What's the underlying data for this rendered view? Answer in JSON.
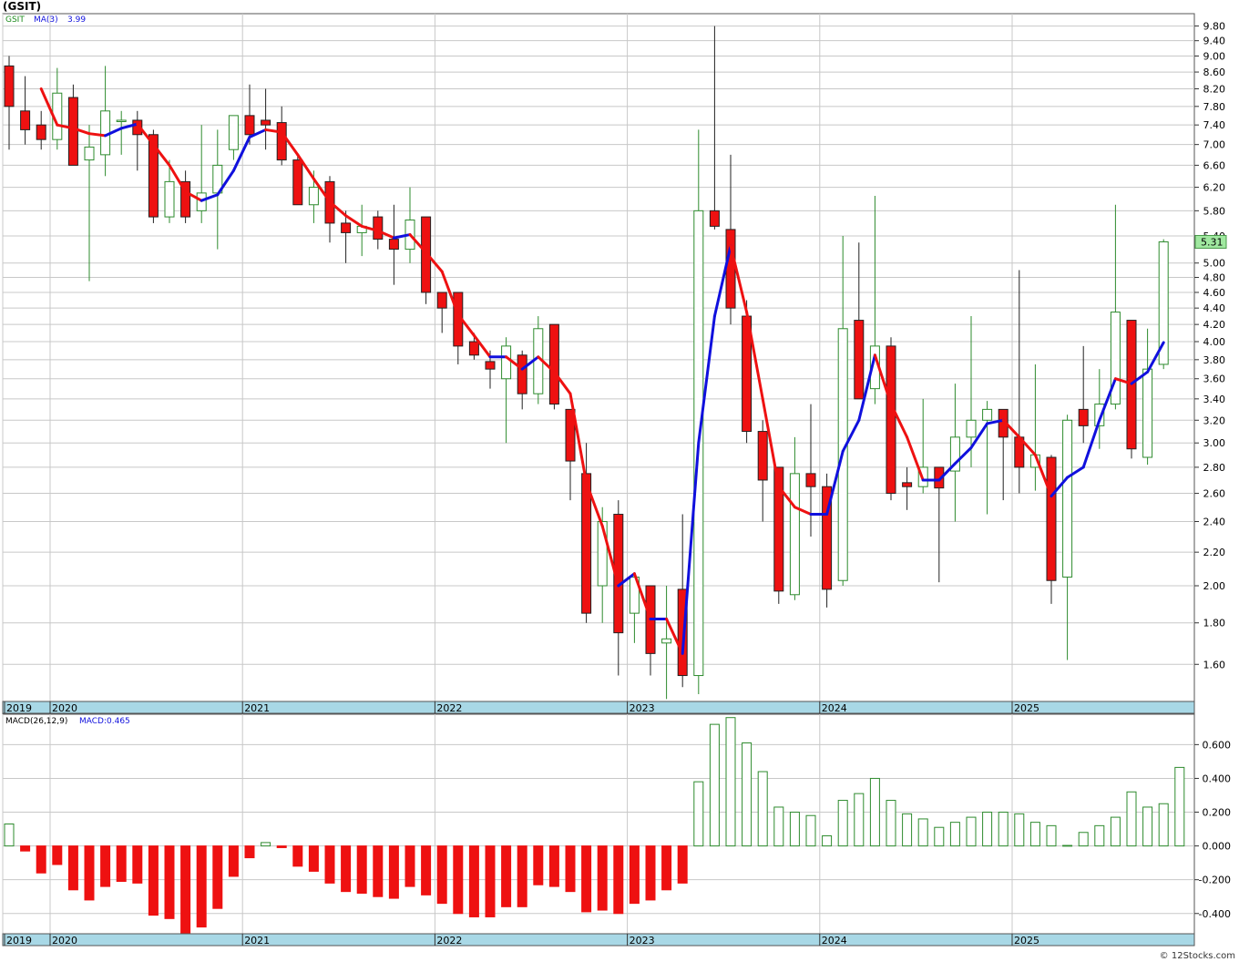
{
  "header": {
    "title": "(GSIT)"
  },
  "footer": {
    "credit": "© 12Stocks.com"
  },
  "colors": {
    "up": "#2e8b2e",
    "down": "#ee1111",
    "ma_up": "#1010dd",
    "ma_down": "#ee1111",
    "axis_band": "#a8d8e6",
    "grid": "#c8c8c8",
    "price_tag_bg": "#a0e8a0"
  },
  "chart_data": [
    {
      "type": "candlestick",
      "panel": "price",
      "symbol_label": "GSIT",
      "ma_label": "MA(3)",
      "ma_value_label": "3.99",
      "scale": "log",
      "ylim": [
        1.44,
        10.15
      ],
      "y_ticks": [
        "9.80",
        "9.40",
        "9.00",
        "8.60",
        "8.20",
        "7.80",
        "7.40",
        "7.00",
        "6.60",
        "6.20",
        "5.80",
        "5.40",
        "5.00",
        "4.80",
        "4.60",
        "4.40",
        "4.20",
        "4.00",
        "3.80",
        "3.60",
        "3.40",
        "3.20",
        "3.00",
        "2.80",
        "2.60",
        "2.40",
        "2.20",
        "2.00",
        "1.80",
        "1.60"
      ],
      "x_tick_labels": [
        "2019",
        "2020",
        "2021",
        "2022",
        "2023",
        "2024",
        "2025"
      ],
      "last_price_label": "5.31",
      "last_price": 5.31,
      "candles": [
        {
          "o": 8.75,
          "h": 9.0,
          "l": 6.9,
          "c": 7.8
        },
        {
          "o": 7.7,
          "h": 8.5,
          "l": 7.0,
          "c": 7.3
        },
        {
          "o": 7.4,
          "h": 7.7,
          "l": 6.9,
          "c": 7.1
        },
        {
          "o": 7.1,
          "h": 8.7,
          "l": 6.9,
          "c": 8.1
        },
        {
          "o": 8.0,
          "h": 8.3,
          "l": 6.6,
          "c": 6.6
        },
        {
          "o": 6.7,
          "h": 7.4,
          "l": 4.75,
          "c": 6.95
        },
        {
          "o": 6.8,
          "h": 8.75,
          "l": 6.4,
          "c": 7.7
        },
        {
          "o": 7.5,
          "h": 7.7,
          "l": 6.8,
          "c": 7.5
        },
        {
          "o": 7.5,
          "h": 7.7,
          "l": 6.5,
          "c": 7.2
        },
        {
          "o": 7.2,
          "h": 7.3,
          "l": 5.6,
          "c": 5.7
        },
        {
          "o": 5.7,
          "h": 6.7,
          "l": 5.6,
          "c": 6.3
        },
        {
          "o": 6.3,
          "h": 6.5,
          "l": 5.6,
          "c": 5.7
        },
        {
          "o": 5.8,
          "h": 7.4,
          "l": 5.6,
          "c": 6.1
        },
        {
          "o": 6.1,
          "h": 7.3,
          "l": 5.2,
          "c": 6.6
        },
        {
          "o": 6.9,
          "h": 7.5,
          "l": 6.7,
          "c": 7.6
        },
        {
          "o": 7.6,
          "h": 8.3,
          "l": 7.0,
          "c": 7.2
        },
        {
          "o": 7.5,
          "h": 8.2,
          "l": 6.9,
          "c": 7.4
        },
        {
          "o": 7.45,
          "h": 7.8,
          "l": 6.6,
          "c": 6.7
        },
        {
          "o": 6.7,
          "h": 6.8,
          "l": 5.9,
          "c": 5.9
        },
        {
          "o": 5.9,
          "h": 6.5,
          "l": 5.6,
          "c": 6.2
        },
        {
          "o": 6.3,
          "h": 6.4,
          "l": 5.3,
          "c": 5.6
        },
        {
          "o": 5.6,
          "h": 5.8,
          "l": 5.0,
          "c": 5.45
        },
        {
          "o": 5.45,
          "h": 5.9,
          "l": 5.1,
          "c": 5.55
        },
        {
          "o": 5.7,
          "h": 5.8,
          "l": 5.2,
          "c": 5.35
        },
        {
          "o": 5.35,
          "h": 5.9,
          "l": 4.7,
          "c": 5.2
        },
        {
          "o": 5.2,
          "h": 6.2,
          "l": 5.0,
          "c": 5.65
        },
        {
          "o": 5.7,
          "h": 5.7,
          "l": 4.45,
          "c": 4.6
        },
        {
          "o": 4.6,
          "h": 4.6,
          "l": 4.1,
          "c": 4.4
        },
        {
          "o": 4.6,
          "h": 4.6,
          "l": 3.75,
          "c": 3.95
        },
        {
          "o": 4.0,
          "h": 4.1,
          "l": 3.8,
          "c": 3.85
        },
        {
          "o": 3.78,
          "h": 3.9,
          "l": 3.5,
          "c": 3.7
        },
        {
          "o": 3.6,
          "h": 4.05,
          "l": 3.0,
          "c": 3.95
        },
        {
          "o": 3.85,
          "h": 3.9,
          "l": 3.3,
          "c": 3.45
        },
        {
          "o": 3.45,
          "h": 4.3,
          "l": 3.35,
          "c": 4.15
        },
        {
          "o": 4.2,
          "h": 4.2,
          "l": 3.3,
          "c": 3.35
        },
        {
          "o": 3.3,
          "h": 3.3,
          "l": 2.55,
          "c": 2.85
        },
        {
          "o": 2.75,
          "h": 3.0,
          "l": 1.8,
          "c": 1.85
        },
        {
          "o": 2.0,
          "h": 2.5,
          "l": 1.8,
          "c": 2.4
        },
        {
          "o": 2.45,
          "h": 2.55,
          "l": 1.55,
          "c": 1.75
        },
        {
          "o": 1.85,
          "h": 2.05,
          "l": 1.7,
          "c": 2.05
        },
        {
          "o": 2.0,
          "h": 2.0,
          "l": 1.55,
          "c": 1.65
        },
        {
          "o": 1.7,
          "h": 2.0,
          "l": 1.45,
          "c": 1.72
        },
        {
          "o": 1.98,
          "h": 2.45,
          "l": 1.5,
          "c": 1.55
        },
        {
          "o": 1.55,
          "h": 7.3,
          "l": 1.47,
          "c": 5.8
        },
        {
          "o": 5.8,
          "h": 9.8,
          "l": 5.5,
          "c": 5.55
        },
        {
          "o": 5.5,
          "h": 6.8,
          "l": 4.2,
          "c": 4.4
        },
        {
          "o": 4.3,
          "h": 4.5,
          "l": 3.0,
          "c": 3.1
        },
        {
          "o": 3.1,
          "h": 3.2,
          "l": 2.4,
          "c": 2.7
        },
        {
          "o": 2.8,
          "h": 2.8,
          "l": 1.9,
          "c": 1.97
        },
        {
          "o": 1.95,
          "h": 3.05,
          "l": 1.92,
          "c": 2.75
        },
        {
          "o": 2.75,
          "h": 3.35,
          "l": 2.3,
          "c": 2.65
        },
        {
          "o": 2.65,
          "h": 2.75,
          "l": 1.88,
          "c": 1.98
        },
        {
          "o": 2.03,
          "h": 5.4,
          "l": 2.0,
          "c": 4.15
        },
        {
          "o": 4.25,
          "h": 5.3,
          "l": 3.4,
          "c": 3.4
        },
        {
          "o": 3.5,
          "h": 6.05,
          "l": 3.35,
          "c": 3.95
        },
        {
          "o": 3.95,
          "h": 4.05,
          "l": 2.55,
          "c": 2.6
        },
        {
          "o": 2.68,
          "h": 2.8,
          "l": 2.48,
          "c": 2.65
        },
        {
          "o": 2.65,
          "h": 3.4,
          "l": 2.6,
          "c": 2.8
        },
        {
          "o": 2.8,
          "h": 2.8,
          "l": 2.02,
          "c": 2.64
        },
        {
          "o": 2.77,
          "h": 3.55,
          "l": 2.4,
          "c": 3.05
        },
        {
          "o": 3.05,
          "h": 4.3,
          "l": 2.8,
          "c": 3.2
        },
        {
          "o": 3.2,
          "h": 3.38,
          "l": 2.45,
          "c": 3.3
        },
        {
          "o": 3.3,
          "h": 3.3,
          "l": 2.55,
          "c": 3.05
        },
        {
          "o": 3.05,
          "h": 4.9,
          "l": 2.6,
          "c": 2.8
        },
        {
          "o": 2.8,
          "h": 3.75,
          "l": 2.62,
          "c": 2.9
        },
        {
          "o": 2.88,
          "h": 2.9,
          "l": 1.9,
          "c": 2.03
        },
        {
          "o": 2.05,
          "h": 3.25,
          "l": 1.62,
          "c": 3.2
        },
        {
          "o": 3.3,
          "h": 3.95,
          "l": 3.0,
          "c": 3.15
        },
        {
          "o": 3.15,
          "h": 3.7,
          "l": 2.95,
          "c": 3.35
        },
        {
          "o": 3.35,
          "h": 5.9,
          "l": 3.3,
          "c": 4.35
        },
        {
          "o": 4.25,
          "h": 4.25,
          "l": 2.87,
          "c": 2.95
        },
        {
          "o": 2.88,
          "h": 4.15,
          "l": 2.82,
          "c": 3.7
        },
        {
          "o": 3.75,
          "h": 5.35,
          "l": 3.7,
          "c": 5.31
        }
      ],
      "ma3": [
        null,
        null,
        8.2,
        7.4,
        7.33,
        7.22,
        7.18,
        7.33,
        7.42,
        7.0,
        6.6,
        6.12,
        5.97,
        6.07,
        6.5,
        7.15,
        7.3,
        7.25,
        6.8,
        6.35,
        5.95,
        5.72,
        5.55,
        5.48,
        5.37,
        5.42,
        5.15,
        4.88,
        4.32,
        4.07,
        3.83,
        3.83,
        3.7,
        3.83,
        3.67,
        3.45,
        2.68,
        2.37,
        2.0,
        2.07,
        1.82,
        1.82,
        1.65,
        3.0,
        4.3,
        5.25,
        4.35,
        3.4,
        2.65,
        2.5,
        2.45,
        2.45,
        2.93,
        3.2,
        3.85,
        3.35,
        3.05,
        2.7,
        2.7,
        2.83,
        2.96,
        3.17,
        3.2,
        3.05,
        2.9,
        2.58,
        2.72,
        2.8,
        3.2,
        3.6,
        3.55,
        3.67,
        3.99
      ]
    },
    {
      "type": "bar",
      "panel": "macd",
      "indicator_label": "MACD(26,12,9)",
      "value_label": "MACD:0.465",
      "ylim": [
        -0.52,
        0.78
      ],
      "y_ticks": [
        "0.600",
        "0.400",
        "0.200",
        "0.000",
        "-0.200",
        "-0.400"
      ],
      "x_tick_labels": [
        "2019",
        "2020",
        "2021",
        "2022",
        "2023",
        "2024",
        "2025"
      ],
      "values": [
        0.13,
        -0.03,
        -0.16,
        -0.11,
        -0.26,
        -0.32,
        -0.24,
        -0.21,
        -0.22,
        -0.41,
        -0.43,
        -0.52,
        -0.48,
        -0.37,
        -0.18,
        -0.07,
        0.02,
        -0.01,
        -0.12,
        -0.15,
        -0.22,
        -0.27,
        -0.28,
        -0.3,
        -0.31,
        -0.24,
        -0.29,
        -0.34,
        -0.4,
        -0.42,
        -0.42,
        -0.36,
        -0.36,
        -0.23,
        -0.24,
        -0.27,
        -0.39,
        -0.38,
        -0.4,
        -0.34,
        -0.32,
        -0.26,
        -0.22,
        0.38,
        0.72,
        0.76,
        0.61,
        0.44,
        0.23,
        0.2,
        0.18,
        0.06,
        0.27,
        0.31,
        0.4,
        0.27,
        0.19,
        0.16,
        0.11,
        0.14,
        0.17,
        0.2,
        0.2,
        0.19,
        0.14,
        0.12,
        0.003,
        0.08,
        0.12,
        0.17,
        0.32,
        0.23,
        0.25,
        0.465
      ]
    }
  ]
}
